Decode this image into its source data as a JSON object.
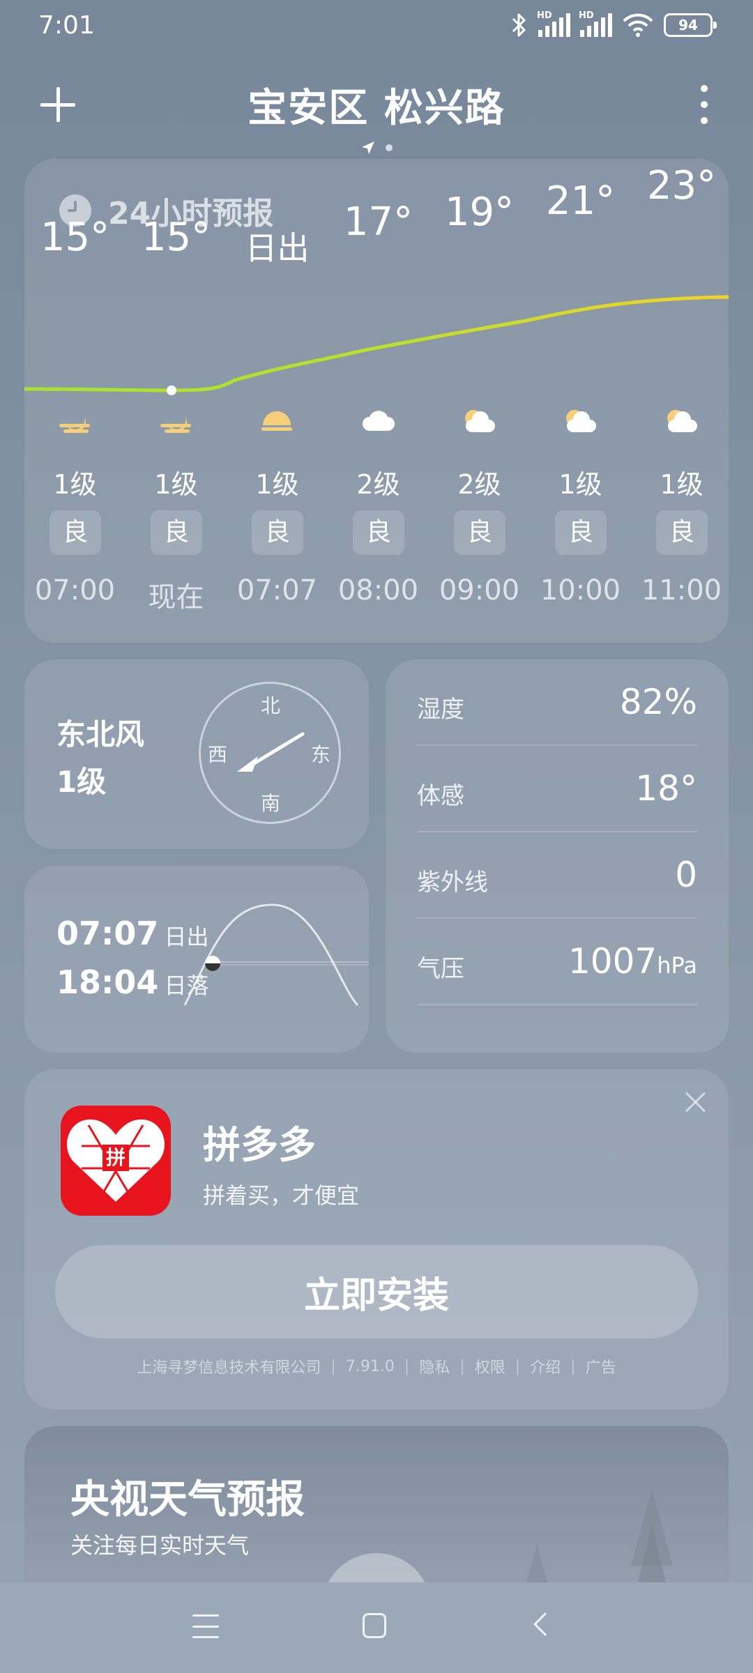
{
  "status_bar": {
    "time": "7:01",
    "battery": "94",
    "signal_badges": [
      "HD",
      "HD"
    ],
    "icons": [
      "bluetooth-icon",
      "signal-icon",
      "signal-icon",
      "wifi-icon",
      "battery-icon"
    ]
  },
  "header": {
    "title": "宝安区 松兴路",
    "add_icon": "plus-icon",
    "more_icon": "more-vertical-icon"
  },
  "forecast": {
    "title": "24小时预报",
    "hours": [
      {
        "temp": "15°",
        "icon": "moon-cloud-icon",
        "wind": "1级",
        "aqi": "良",
        "time": "07:00"
      },
      {
        "temp": "15°",
        "icon": "moon-cloud-icon",
        "wind": "1级",
        "aqi": "良",
        "time": "现在"
      },
      {
        "temp": "日出",
        "icon": "sunrise-icon",
        "wind": "1级",
        "aqi": "良",
        "time": "07:07"
      },
      {
        "temp": "17°",
        "icon": "cloudy-icon",
        "wind": "2级",
        "aqi": "良",
        "time": "08:00"
      },
      {
        "temp": "19°",
        "icon": "partly-cloudy-icon",
        "wind": "2级",
        "aqi": "良",
        "time": "09:00"
      },
      {
        "temp": "21°",
        "icon": "partly-cloudy-icon",
        "wind": "1级",
        "aqi": "良",
        "time": "10:00"
      },
      {
        "temp": "23°",
        "icon": "partly-cloudy-icon",
        "wind": "1级",
        "aqi": "良",
        "time": "11:00"
      }
    ]
  },
  "wind": {
    "direction": "东北风",
    "level": "1级",
    "compass": {
      "n": "北",
      "s": "南",
      "e": "东",
      "w": "西"
    }
  },
  "sun": {
    "sunrise_time": "07:07",
    "sunrise_label": "日出",
    "sunset_time": "18:04",
    "sunset_label": "日落"
  },
  "details": [
    {
      "label": "湿度",
      "value": "82%",
      "unit": ""
    },
    {
      "label": "体感",
      "value": "18°",
      "unit": ""
    },
    {
      "label": "紫外线",
      "value": "0",
      "unit": ""
    },
    {
      "label": "气压",
      "value": "1007",
      "unit": "hPa"
    }
  ],
  "ad": {
    "app_name": "拼多多",
    "slogan": "拼着买，才便宜",
    "install_label": "立即安装",
    "logo_text": "拼",
    "meta": [
      "上海寻梦信息技术有限公司",
      "7.91.0",
      "隐私",
      "权限",
      "介绍",
      "广告"
    ],
    "meta_sep": "|"
  },
  "cctv": {
    "title": "央视天气预报",
    "subtitle": "关注每日实时天气"
  },
  "colors": {
    "line_green": "#a6e22e",
    "line_yellow": "#f2d22a",
    "brand_red": "#e8141d",
    "sun_yellow": "#f6cf7a"
  }
}
